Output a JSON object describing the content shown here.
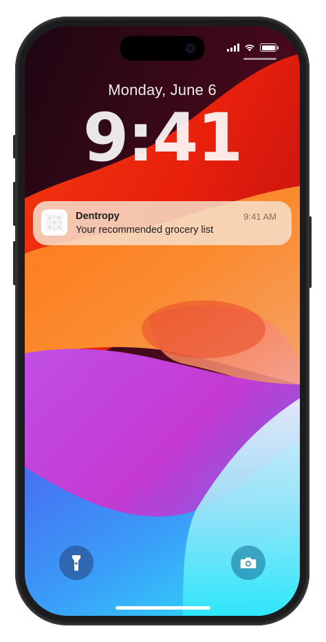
{
  "status_bar": {
    "signal_icon": "cellular-signal-icon",
    "wifi_icon": "wifi-icon",
    "battery_icon": "battery-full-icon"
  },
  "lock_screen": {
    "date": "Monday, June 6",
    "time": "9:41"
  },
  "notification": {
    "app_name": "Dentropy",
    "message": "Your recommended grocery list",
    "timestamp": "9:41 AM",
    "icon": "app-icon"
  },
  "quick_actions": {
    "left_icon": "flashlight-icon",
    "right_icon": "camera-icon"
  },
  "colors": {
    "frame": "#1c1c1e",
    "wallpaper_red": "#e8280e",
    "wallpaper_orange": "#fb8a2e",
    "wallpaper_purple": "#b73ad8",
    "wallpaper_cyan": "#2ee8fb",
    "notification_bg": "#f6deca"
  }
}
